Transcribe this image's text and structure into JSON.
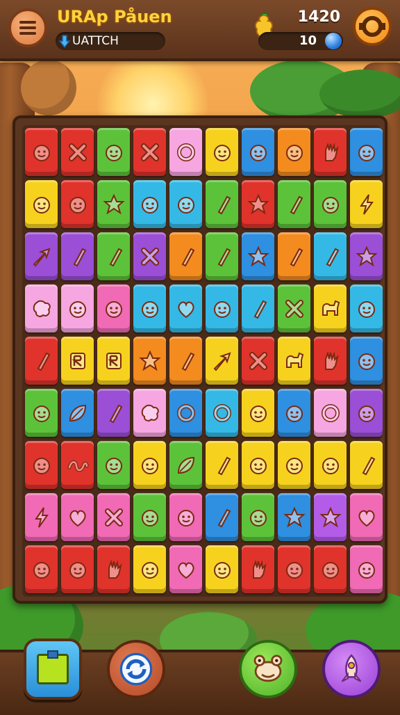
{
  "header": {
    "title": "URAp Påuen",
    "subtitle": "UATTCH",
    "score": "1420",
    "coins": "10"
  },
  "colors": {
    "red": "#e0332c",
    "yellow": "#f6d21e",
    "green": "#5cc23a",
    "blue": "#2f8fe0",
    "cyan": "#34b9e6",
    "pink": "#f06ab5",
    "purple": "#9a4fd6",
    "orange": "#f38b1f",
    "lightpink": "#f6a6e0",
    "violet": "#b25ce8"
  },
  "board": {
    "rows": [
      [
        [
          "red",
          "face"
        ],
        [
          "red",
          "x"
        ],
        [
          "green",
          "face"
        ],
        [
          "red",
          "x"
        ],
        [
          "lightpink",
          "ring"
        ],
        [
          "yellow",
          "face"
        ],
        [
          "blue",
          "face"
        ],
        [
          "orange",
          "face"
        ],
        [
          "red",
          "hand"
        ],
        [
          "blue",
          "face"
        ]
      ],
      [
        [
          "yellow",
          "face"
        ],
        [
          "red",
          "face"
        ],
        [
          "green",
          "star"
        ],
        [
          "cyan",
          "face"
        ],
        [
          "cyan",
          "face"
        ],
        [
          "green",
          "slash"
        ],
        [
          "red",
          "star"
        ],
        [
          "green",
          "slash"
        ],
        [
          "green",
          "face"
        ],
        [
          "yellow",
          "bolt"
        ]
      ],
      [
        [
          "purple",
          "arrow"
        ],
        [
          "purple",
          "slash"
        ],
        [
          "green",
          "slash"
        ],
        [
          "purple",
          "x"
        ],
        [
          "orange",
          "slash"
        ],
        [
          "green",
          "slash"
        ],
        [
          "blue",
          "star"
        ],
        [
          "orange",
          "slash"
        ],
        [
          "cyan",
          "slash"
        ],
        [
          "purple",
          "star"
        ]
      ],
      [
        [
          "lightpink",
          "blob"
        ],
        [
          "lightpink",
          "face"
        ],
        [
          "pink",
          "face"
        ],
        [
          "cyan",
          "face"
        ],
        [
          "cyan",
          "heart"
        ],
        [
          "cyan",
          "face"
        ],
        [
          "cyan",
          "slash"
        ],
        [
          "green",
          "x"
        ],
        [
          "yellow",
          "dino"
        ],
        [
          "cyan",
          "face"
        ]
      ],
      [
        [
          "red",
          "slash"
        ],
        [
          "yellow",
          "letter"
        ],
        [
          "yellow",
          "letter"
        ],
        [
          "orange",
          "star"
        ],
        [
          "orange",
          "slash"
        ],
        [
          "yellow",
          "arrow"
        ],
        [
          "red",
          "x"
        ],
        [
          "yellow",
          "dino"
        ],
        [
          "red",
          "hand"
        ],
        [
          "blue",
          "face"
        ]
      ],
      [
        [
          "green",
          "face"
        ],
        [
          "blue",
          "leaf"
        ],
        [
          "purple",
          "slash"
        ],
        [
          "lightpink",
          "blob"
        ],
        [
          "blue",
          "ring"
        ],
        [
          "cyan",
          "ring"
        ],
        [
          "yellow",
          "face"
        ],
        [
          "blue",
          "face"
        ],
        [
          "lightpink",
          "ring"
        ],
        [
          "purple",
          "face"
        ]
      ],
      [
        [
          "red",
          "face"
        ],
        [
          "red",
          "squiggle"
        ],
        [
          "green",
          "face"
        ],
        [
          "yellow",
          "face"
        ],
        [
          "green",
          "leaf"
        ],
        [
          "yellow",
          "slash"
        ],
        [
          "yellow",
          "face"
        ],
        [
          "yellow",
          "face"
        ],
        [
          "yellow",
          "face"
        ],
        [
          "yellow",
          "slash"
        ]
      ],
      [
        [
          "pink",
          "bolt"
        ],
        [
          "pink",
          "heart"
        ],
        [
          "pink",
          "x"
        ],
        [
          "green",
          "face"
        ],
        [
          "pink",
          "face"
        ],
        [
          "blue",
          "slash"
        ],
        [
          "green",
          "face"
        ],
        [
          "blue",
          "star"
        ],
        [
          "violet",
          "star"
        ],
        [
          "pink",
          "heart"
        ]
      ],
      [
        [
          "red",
          "face"
        ],
        [
          "red",
          "face"
        ],
        [
          "red",
          "hand"
        ],
        [
          "yellow",
          "face"
        ],
        [
          "pink",
          "heart"
        ],
        [
          "yellow",
          "face"
        ],
        [
          "red",
          "hand"
        ],
        [
          "red",
          "face"
        ],
        [
          "red",
          "face"
        ],
        [
          "pink",
          "face"
        ]
      ]
    ]
  },
  "bottom_buttons": {
    "left": "square-block-icon",
    "center_left": "refresh-icon",
    "center_right": "frog-icon",
    "right": "rocket-icon"
  }
}
